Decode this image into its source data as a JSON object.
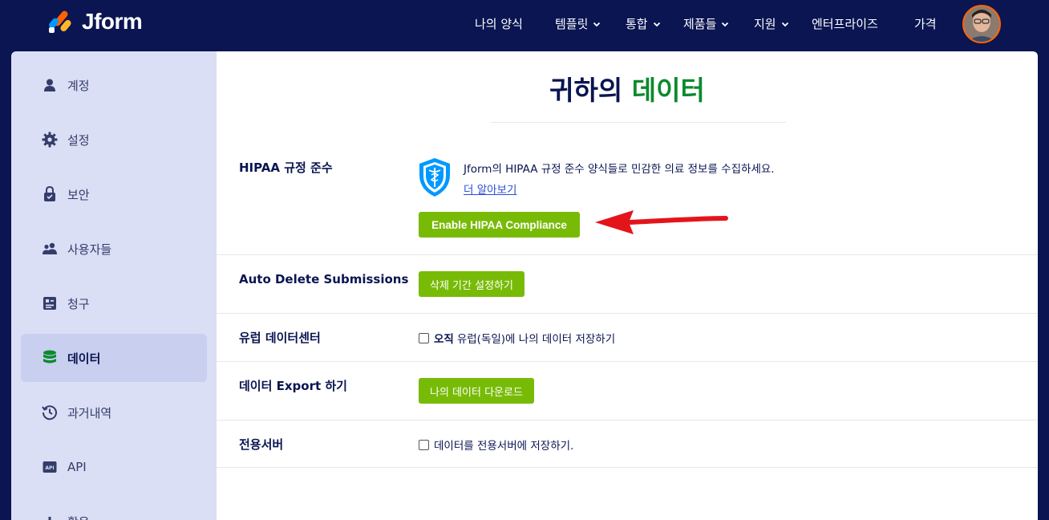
{
  "brand": {
    "name": "Jform"
  },
  "nav": {
    "items": [
      {
        "label": "나의 양식",
        "dropdown": false
      },
      {
        "label": "템플릿",
        "dropdown": true
      },
      {
        "label": "통합",
        "dropdown": true
      },
      {
        "label": "제품들",
        "dropdown": true
      },
      {
        "label": "지원",
        "dropdown": true
      },
      {
        "label": "엔터프라이즈",
        "dropdown": false
      },
      {
        "label": "가격",
        "dropdown": false
      }
    ]
  },
  "sidebar": {
    "items": [
      {
        "label": "계정",
        "icon": "user-icon",
        "active": false
      },
      {
        "label": "설정",
        "icon": "gear-icon",
        "active": false
      },
      {
        "label": "보안",
        "icon": "lock-icon",
        "active": false
      },
      {
        "label": "사용자들",
        "icon": "users-icon",
        "active": false
      },
      {
        "label": "청구",
        "icon": "billing-icon",
        "active": false
      },
      {
        "label": "데이터",
        "icon": "database-icon",
        "active": true
      },
      {
        "label": "과거내역",
        "icon": "history-icon",
        "active": false
      },
      {
        "label": "API",
        "icon": "api-icon",
        "active": false
      },
      {
        "label": "활용",
        "icon": "usage-icon",
        "active": false
      }
    ]
  },
  "page": {
    "title_prefix": "귀하의 ",
    "title_highlight": "데이터"
  },
  "sections": {
    "hipaa": {
      "label": "HIPAA 규정 준수",
      "description": "Jform의 HIPAA 규정 준수 양식들로 민감한 의료 정보를 수집하세요.",
      "link": "더 알아보기",
      "button": "Enable HIPAA Compliance"
    },
    "auto_delete": {
      "label": "Auto Delete Submissions",
      "button": "삭제 기간 설정하기"
    },
    "eu_datacenter": {
      "label": "유럽 데이터센터",
      "checkbox_strong": "오직",
      "checkbox_text": "유럽(독일)에 나의 데이터 저장하기",
      "checked": false
    },
    "export": {
      "label": "데이터 Export 하기",
      "button": "나의 데이터 다운로드"
    },
    "dedicated": {
      "label": "전용서버",
      "checkbox_text": "데이터를 전용서버에 저장하기.",
      "checked": false
    }
  },
  "colors": {
    "nav_bg": "#0a1551",
    "accent_green": "#78bb07",
    "title_green": "#0d8a2e",
    "sidebar_bg": "#dadff5",
    "arrow_red": "#e3151a",
    "link_blue": "#2b4fd7"
  }
}
